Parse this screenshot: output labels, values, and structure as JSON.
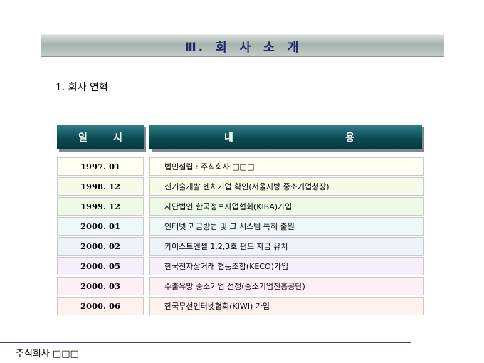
{
  "slide": {
    "title": "Ⅲ.  회 사 소 개",
    "section_title": "1. 회사 연혁"
  },
  "table": {
    "header_date_left": "일",
    "header_date_right": "시",
    "header_content_left": "내",
    "header_content_right": "용",
    "rows": [
      {
        "date": "1997. 01",
        "content": "법인설립 : 주식회사 □□□",
        "bg": "#fffff0"
      },
      {
        "date": "1998. 12",
        "content": "신기술개발 벤처기업 확인(서울지방 중소기업청장)",
        "bg": "#f4fbe6"
      },
      {
        "date": "1999. 12",
        "content": "사단법인 한국정보사업협회(KIBA)가입",
        "bg": "#eefae6"
      },
      {
        "date": "2000. 01",
        "content": "인터넷 과금방법 및 그 시스템 특허 출원",
        "bg": "#eef8f6"
      },
      {
        "date": "2000. 02",
        "content": "카이스트엔젤 1,2,3호 펀드 자금 유치",
        "bg": "#eef2fb"
      },
      {
        "date": "2000. 05",
        "content": "한국전자상거래 협동조합(KECO)가입",
        "bg": "#f6eefb"
      },
      {
        "date": "2000. 03",
        "content": "수출유망 중소기업 선정(중소기업진흥공단)",
        "bg": "#fdf0f4"
      },
      {
        "date": "2000. 06",
        "content": "한국무선인터넷협회(KIWI) 가입",
        "bg": "#fff1ee"
      }
    ]
  },
  "footer": {
    "company": "주식회사 □□□"
  },
  "colors": {
    "title_text": "#1b2a66",
    "header_bg": "#0b4a52",
    "footer_line": "#3d3580"
  }
}
